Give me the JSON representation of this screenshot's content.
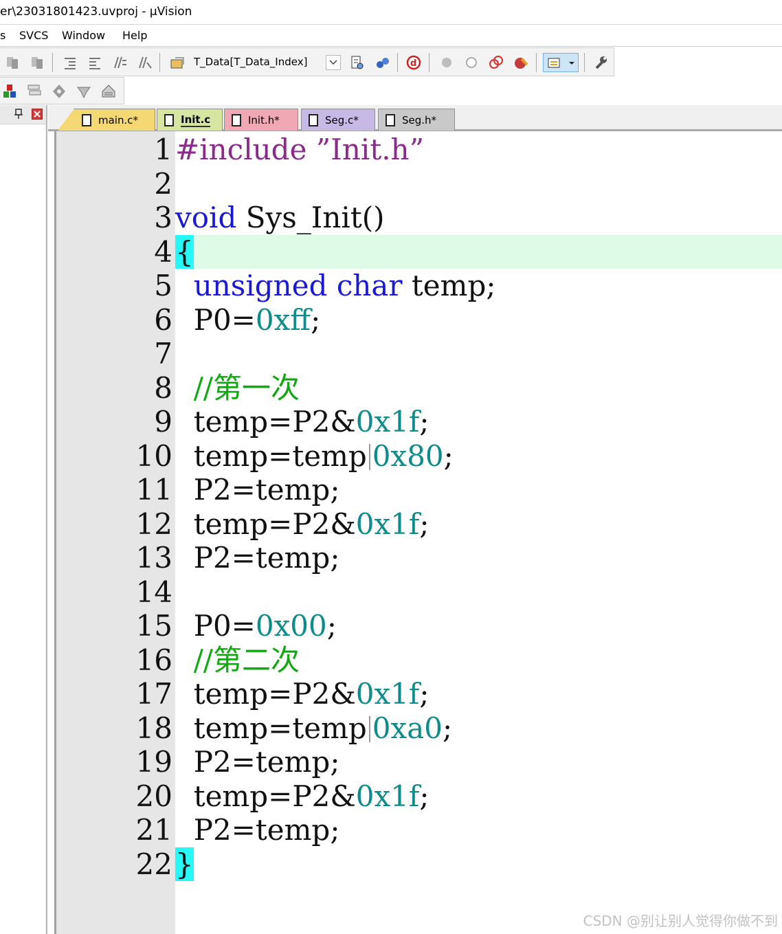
{
  "window": {
    "title": "er\\23031801423.uvproj - µVision"
  },
  "menu": [
    "s",
    "SVCS",
    "Window",
    "Help"
  ],
  "toolbar": {
    "target_combo": "T_Data[T_Data_Index]"
  },
  "tabs": [
    {
      "label": "main.c*",
      "color": "#f4d873"
    },
    {
      "label": "Init.c",
      "color": "#d6e5a0",
      "active": true
    },
    {
      "label": "Init.h*",
      "color": "#f0a8b4"
    },
    {
      "label": "Seg.c*",
      "color": "#c7b9e6"
    },
    {
      "label": "Seg.h*",
      "color": "#c9c9c9"
    }
  ],
  "editor": {
    "highlight_line": 4,
    "lines": [
      {
        "n": "1",
        "tokens": [
          {
            "t": "#include ",
            "c": "pp"
          },
          {
            "t": "”Init.h”",
            "c": "pp"
          }
        ]
      },
      {
        "n": "2",
        "tokens": []
      },
      {
        "n": "3",
        "tokens": [
          {
            "t": "void",
            "c": "kw"
          },
          {
            "t": " Sys_Init()",
            "c": ""
          }
        ]
      },
      {
        "n": "4",
        "tokens": [
          {
            "t": "{",
            "c": "br"
          }
        ]
      },
      {
        "n": "5",
        "tokens": [
          {
            "t": "  ",
            "c": ""
          },
          {
            "t": "unsigned",
            "c": "kw"
          },
          {
            "t": " ",
            "c": ""
          },
          {
            "t": "char",
            "c": "kw"
          },
          {
            "t": " temp;",
            "c": ""
          }
        ]
      },
      {
        "n": "6",
        "tokens": [
          {
            "t": "  P0=",
            "c": ""
          },
          {
            "t": "0xff",
            "c": "num"
          },
          {
            "t": ";",
            "c": ""
          }
        ]
      },
      {
        "n": "7",
        "tokens": []
      },
      {
        "n": "8",
        "tokens": [
          {
            "t": "  ",
            "c": ""
          },
          {
            "t": "//第一次",
            "c": "cmt"
          }
        ]
      },
      {
        "n": "9",
        "tokens": [
          {
            "t": "  temp=P2&",
            "c": ""
          },
          {
            "t": "0x1f",
            "c": "num"
          },
          {
            "t": ";",
            "c": ""
          }
        ]
      },
      {
        "n": "10",
        "tokens": [
          {
            "t": "  temp=temp",
            "c": ""
          },
          {
            "t": "|",
            "c": "bar"
          },
          {
            "t": "0x80",
            "c": "num"
          },
          {
            "t": ";",
            "c": ""
          }
        ]
      },
      {
        "n": "11",
        "tokens": [
          {
            "t": "  P2=temp;",
            "c": ""
          }
        ]
      },
      {
        "n": "12",
        "tokens": [
          {
            "t": "  temp=P2&",
            "c": ""
          },
          {
            "t": "0x1f",
            "c": "num"
          },
          {
            "t": ";",
            "c": ""
          }
        ]
      },
      {
        "n": "13",
        "tokens": [
          {
            "t": "  P2=temp;",
            "c": ""
          }
        ]
      },
      {
        "n": "14",
        "tokens": []
      },
      {
        "n": "15",
        "tokens": [
          {
            "t": "  P0=",
            "c": ""
          },
          {
            "t": "0x00",
            "c": "num"
          },
          {
            "t": ";",
            "c": ""
          }
        ]
      },
      {
        "n": "16",
        "tokens": [
          {
            "t": "  ",
            "c": ""
          },
          {
            "t": "//第二次",
            "c": "cmt"
          }
        ]
      },
      {
        "n": "17",
        "tokens": [
          {
            "t": "  temp=P2&",
            "c": ""
          },
          {
            "t": "0x1f",
            "c": "num"
          },
          {
            "t": ";",
            "c": ""
          }
        ]
      },
      {
        "n": "18",
        "tokens": [
          {
            "t": "  temp=temp",
            "c": ""
          },
          {
            "t": "|",
            "c": "bar"
          },
          {
            "t": "0xa0",
            "c": "num"
          },
          {
            "t": ";",
            "c": ""
          }
        ]
      },
      {
        "n": "19",
        "tokens": [
          {
            "t": "  P2=temp;",
            "c": ""
          }
        ]
      },
      {
        "n": "20",
        "tokens": [
          {
            "t": "  temp=P2&",
            "c": ""
          },
          {
            "t": "0x1f",
            "c": "num"
          },
          {
            "t": ";",
            "c": ""
          }
        ]
      },
      {
        "n": "21",
        "tokens": [
          {
            "t": "  P2=temp;",
            "c": ""
          }
        ]
      },
      {
        "n": "22",
        "tokens": [
          {
            "t": "}",
            "c": "br"
          }
        ]
      }
    ]
  },
  "watermark": "CSDN @别让别人觉得你做不到"
}
